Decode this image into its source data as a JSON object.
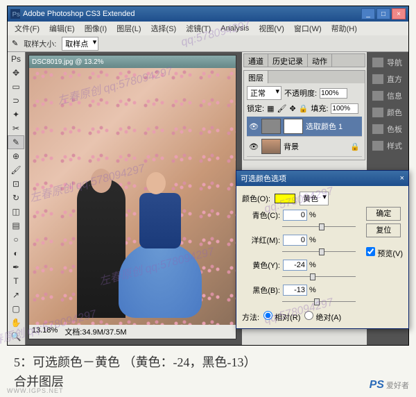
{
  "app": {
    "title": "Adobe Photoshop CS3 Extended",
    "menus": [
      "文件(F)",
      "编辑(E)",
      "图像(I)",
      "图层(L)",
      "选择(S)",
      "滤镜(T)",
      "Analysis",
      "视图(V)",
      "窗口(W)",
      "帮助(H)"
    ]
  },
  "options": {
    "label": "取样大小:",
    "value": "取样点"
  },
  "document": {
    "title": "DSC8019.jpg @ 13.2%",
    "zoom": "13.18%",
    "filesize": "文档:34.9M/37.5M"
  },
  "panels": {
    "nav_tabs": [
      "通道",
      "历史记录",
      "动作"
    ],
    "layers_tab": "图层",
    "blend_mode": "正常",
    "opacity_label": "不透明度:",
    "opacity_value": "100%",
    "lock_label": "锁定:",
    "fill_label": "填充:",
    "fill_value": "100%",
    "layers": [
      {
        "name": "选取颜色 1",
        "active": true
      },
      {
        "name": "背景",
        "active": false
      }
    ],
    "side": [
      "导航",
      "直方",
      "信息",
      "颜色",
      "色板",
      "样式"
    ]
  },
  "dialog": {
    "title": "可选颜色选项",
    "color_label": "颜色(O):",
    "color_name": "黄色",
    "fields": {
      "cyan": {
        "label": "青色(C):",
        "value": "0"
      },
      "magenta": {
        "label": "洋红(M):",
        "value": "0"
      },
      "yellow": {
        "label": "黄色(Y):",
        "value": "-24"
      },
      "black": {
        "label": "黑色(B):",
        "value": "-13"
      }
    },
    "method_label": "方法:",
    "method_relative": "相对(R)",
    "method_absolute": "绝对(A)",
    "buttons": {
      "ok": "确定",
      "cancel": "复位"
    },
    "preview": "预览(V)"
  },
  "watermarks": {
    "text1": "左春原创 qq:578094297",
    "text2": "qq:578094297"
  },
  "caption": {
    "line1": "5：可选颜色－黄色 （黄色：-24，黑色-13）",
    "line2": "合并图层"
  },
  "footer": {
    "brand": "PS",
    "brand_text": "爱好者",
    "site": "WWW.IGPS.NET"
  }
}
